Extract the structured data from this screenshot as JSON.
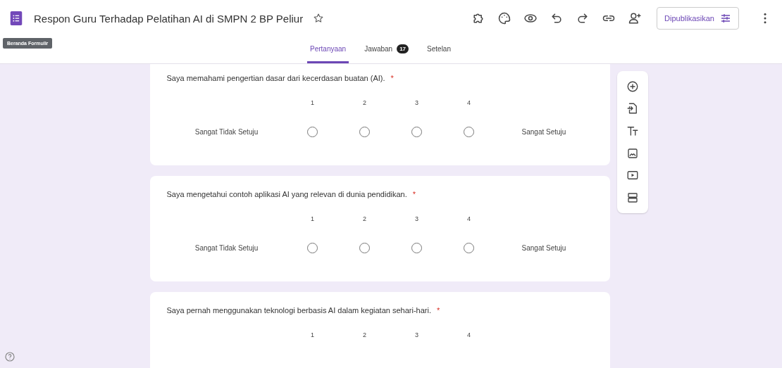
{
  "header": {
    "title": "Respon Guru Terhadap Pelatihan AI di SMPN 2 BP Peliur",
    "publish_button": "Dipublikasikan",
    "tooltip": "Beranda Formulir"
  },
  "tabs": [
    {
      "label": "Pertanyaan",
      "selected": true
    },
    {
      "label": "Jawaban",
      "selected": false,
      "badge": "17"
    },
    {
      "label": "Setelan",
      "selected": false
    }
  ],
  "questions": [
    {
      "text": "Saya memahami pengertian dasar dari kecerdasan buatan (AI).",
      "required_mark": "*",
      "scale": [
        "1",
        "2",
        "3",
        "4"
      ],
      "low_label": "Sangat Tidak Setuju",
      "high_label": "Sangat Setuju",
      "options": [
        {
          "selected": false
        },
        {
          "selected": false
        },
        {
          "selected": false
        },
        {
          "selected": false
        }
      ]
    },
    {
      "text": "Saya mengetahui contoh aplikasi AI yang relevan di dunia pendidikan.",
      "required_mark": "*",
      "scale": [
        "1",
        "2",
        "3",
        "4"
      ],
      "low_label": "Sangat Tidak Setuju",
      "high_label": "Sangat Setuju",
      "options": [
        {
          "selected": false
        },
        {
          "selected": false
        },
        {
          "selected": false
        },
        {
          "selected": false
        }
      ]
    },
    {
      "text": "Saya pernah menggunakan teknologi berbasis AI dalam kegiatan sehari-hari.",
      "required_mark": "*",
      "scale": [
        "1",
        "2",
        "3",
        "4"
      ]
    }
  ]
}
